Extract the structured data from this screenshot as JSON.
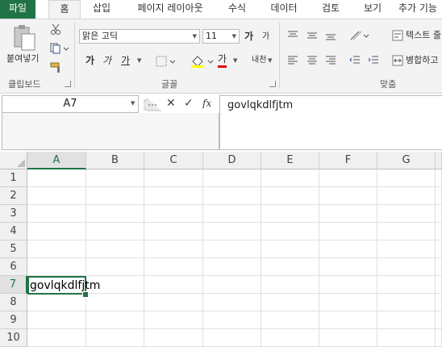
{
  "tabs": [
    "파일",
    "홈",
    "삽입",
    "페이지 레이아웃",
    "수식",
    "데이터",
    "검토",
    "보기",
    "추가 기능"
  ],
  "ribbon": {
    "clipboard": {
      "paste_label": "붙여넣기",
      "group_label": "클립보드"
    },
    "font": {
      "font_name": "맑은 고딕",
      "font_size": "11",
      "grow_label": "가",
      "shrink_label": "가",
      "bold_label": "가",
      "italic_label": "가",
      "underline_label": "가",
      "font_color_label": "가",
      "phonetic_label": "내천",
      "group_label": "글꼴"
    },
    "alignment": {
      "wrap_text_label": "텍스트 줄",
      "merge_label": "병합하고",
      "group_label": "맞춤"
    }
  },
  "formula_bar": {
    "name_box": "A7",
    "fx_label": "fx",
    "formula": "govlqkdlfjtm"
  },
  "sheet": {
    "columns": [
      "A",
      "B",
      "C",
      "D",
      "E",
      "F",
      "G"
    ],
    "rows": [
      "1",
      "2",
      "3",
      "4",
      "5",
      "6",
      "7",
      "8",
      "9",
      "10"
    ],
    "active_cell": "A7",
    "cell_a7": "govlqkdlfjtm"
  },
  "colors": {
    "accent": "#217346",
    "ribbon_bg": "#f3f3f3",
    "header_bg": "#f0f0f0"
  }
}
